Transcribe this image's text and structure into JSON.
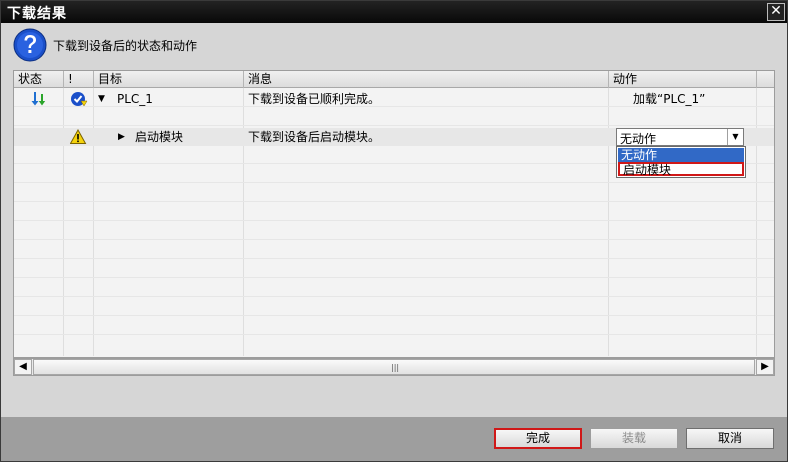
{
  "window": {
    "title": "下载结果",
    "close_glyph": "✕"
  },
  "header": {
    "description": "下载到设备后的状态和动作"
  },
  "columns": {
    "status": "状态",
    "alert": "!",
    "target": "目标",
    "message": "消息",
    "action": "动作"
  },
  "rows": [
    {
      "expander": "▼",
      "target": "PLC_1",
      "message": "下载到设备已顺利完成。",
      "action": "加载“PLC_1”"
    },
    {
      "expander": "▶",
      "target": "启动模块",
      "message": "下载到设备后启动模块。",
      "action": ""
    }
  ],
  "dropdown": {
    "selected": "无动作",
    "arrow": "▼",
    "options": [
      "无动作",
      "启动模块"
    ]
  },
  "scrollbar": {
    "left": "◀",
    "right": "▶",
    "grip": "|||"
  },
  "buttons": {
    "finish": "完成",
    "load": "装载",
    "cancel": "取消"
  },
  "colors": {
    "highlight_blue": "#3169c6",
    "outline_red": "#d01818",
    "warning_yellow": "#f4d20c"
  },
  "icons": {
    "header": "question-icon",
    "row1_status": "download-arrows-icon",
    "row1_alert": "check-badge-icon",
    "row2_alert": "warning-icon"
  }
}
